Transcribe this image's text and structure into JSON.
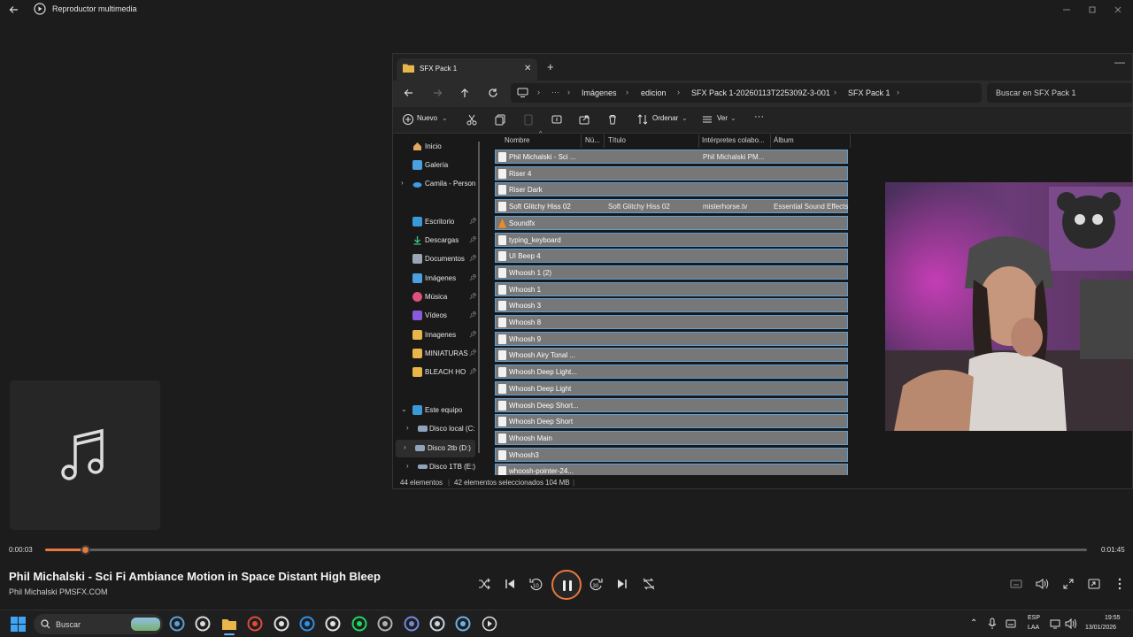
{
  "player": {
    "title": "Reproductor multimedia",
    "time_current": "0:00:03",
    "time_total": "0:01:45",
    "progress_fraction": 0.038,
    "track_title": "Phil Michalski - Sci Fi Ambiance Motion in Space Distant High Bleep",
    "track_artist": "Phil Michalski PMSFX.COM",
    "accent_color": "#e6773f",
    "controls": [
      "shuffle-icon",
      "previous-icon",
      "rewind-10-icon",
      "pause-icon",
      "forward-30-icon",
      "next-icon",
      "repeat-off-icon"
    ],
    "rewind_label": "10",
    "forward_label": "30"
  },
  "explorer": {
    "tab_label": "SFX Pack 1",
    "breadcrumb": [
      "Imágenes",
      "edicion",
      "SFX Pack 1-20260113T225309Z-3-001",
      "SFX Pack 1"
    ],
    "search_placeholder": "Buscar en SFX Pack 1",
    "toolbar": {
      "new_label": "Nuevo",
      "sort_label": "Ordenar",
      "view_label": "Ver",
      "more_label": "···"
    },
    "nav": {
      "home": "Inicio",
      "gallery": "Galería",
      "onedrive": "Camila - Person",
      "desktop": "Escritorio",
      "downloads": "Descargas",
      "documents": "Documentos",
      "pictures": "Imágenes",
      "music": "Música",
      "videos": "Vídeos",
      "imagenes": "Imagenes",
      "miniaturas": "MINIATURAS",
      "bleach": "BLEACH HO",
      "this_pc": "Este equipo",
      "disk_c": "Disco local (C:",
      "disk_d": "Disco 2tb (D:)",
      "disk_e": "Disco 1TB (E:)"
    },
    "columns": {
      "name": "Nombre",
      "number": "Nú...",
      "title": "Título",
      "artists": "Intérpretes colabo...",
      "album": "Álbum"
    },
    "files": [
      {
        "name": "Phil Michalski - Sci ...",
        "title": "",
        "artist": "Phil Michalski PM...",
        "album": ""
      },
      {
        "name": "Riser 4",
        "title": "",
        "artist": "",
        "album": ""
      },
      {
        "name": "Riser Dark",
        "title": "",
        "artist": "",
        "album": ""
      },
      {
        "name": "Soft Glitchy Hiss 02",
        "title": "Soft Glitchy Hiss 02",
        "artist": "misterhorse.tv",
        "album": "Essential Sound Effects"
      },
      {
        "name": "Soundfx",
        "title": "",
        "artist": "",
        "album": ""
      },
      {
        "name": "typing_keyboard",
        "title": "",
        "artist": "",
        "album": ""
      },
      {
        "name": "UI Beep 4",
        "title": "",
        "artist": "",
        "album": ""
      },
      {
        "name": "Whoosh 1 (2)",
        "title": "",
        "artist": "",
        "album": ""
      },
      {
        "name": "Whoosh 1",
        "title": "",
        "artist": "",
        "album": ""
      },
      {
        "name": "Whoosh 3",
        "title": "",
        "artist": "",
        "album": ""
      },
      {
        "name": "Whoosh 8",
        "title": "",
        "artist": "",
        "album": ""
      },
      {
        "name": "Whoosh 9",
        "title": "",
        "artist": "",
        "album": ""
      },
      {
        "name": "Whoosh Airy Tonal ...",
        "title": "",
        "artist": "",
        "album": ""
      },
      {
        "name": "Whoosh Deep Light...",
        "title": "",
        "artist": "",
        "album": ""
      },
      {
        "name": "Whoosh Deep Light",
        "title": "",
        "artist": "",
        "album": ""
      },
      {
        "name": "Whoosh Deep Short...",
        "title": "",
        "artist": "",
        "album": ""
      },
      {
        "name": "Whoosh Deep Short",
        "title": "",
        "artist": "",
        "album": ""
      },
      {
        "name": "Whoosh Main",
        "title": "",
        "artist": "",
        "album": ""
      },
      {
        "name": "Whoosh3",
        "title": "",
        "artist": "",
        "album": ""
      },
      {
        "name": "whoosh-pointer-24...",
        "title": "",
        "artist": "",
        "album": ""
      }
    ],
    "status": {
      "count": "44 elementos",
      "selected": "42 elementos seleccionados",
      "size": "104 MB"
    }
  },
  "taskbar": {
    "search_label": "Buscar",
    "lang": "ESP",
    "lang_sub": "LAA",
    "time": "19:55",
    "date": "13/01/2026",
    "apps": [
      "widgets-icon",
      "chatgpt-icon",
      "file-explorer-icon",
      "chrome-icon",
      "obs-icon",
      "edge-icon",
      "steam-icon",
      "spotify-icon",
      "gamepad-icon",
      "discord-icon",
      "steam-vr-icon",
      "vegas-icon",
      "media-player-icon"
    ]
  }
}
